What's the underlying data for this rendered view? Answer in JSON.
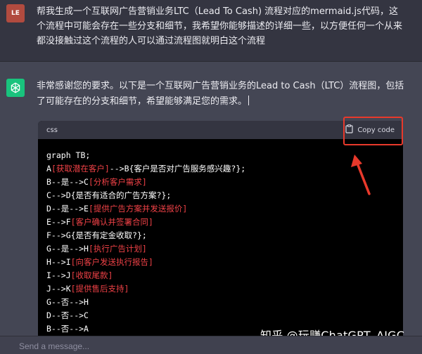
{
  "user_message": {
    "avatar_initials": "LE",
    "text": "帮我生成一个互联网广告营销业务LTC（Lead To Cash) 流程对应的mermaid.js代码，这个流程中可能会存在一些分支和细节，我希望你能够描述的详细一些，以方便任何一个从来都没接触过这个流程的人可以通过流程图就明白这个流程"
  },
  "assistant_message": {
    "text": "非常感谢您的要求。以下是一个互联网广告营销业务的Lead to Cash（LTC）流程图，包括了可能存在的分支和细节，希望能够满足您的需求。"
  },
  "code_block": {
    "language": "css",
    "copy_label": "Copy code",
    "lines": [
      [
        {
          "t": "graph TB;"
        }
      ],
      [
        {
          "t": "A"
        },
        {
          "t": "[获取潜在客户]",
          "h": true
        },
        {
          "t": "-->B{客户是否对广告服务感兴趣?};"
        }
      ],
      [
        {
          "t": "B--是-->C"
        },
        {
          "t": "[分析客户需求]",
          "h": true
        }
      ],
      [
        {
          "t": "C-->D{是否有适合的广告方案?};"
        }
      ],
      [
        {
          "t": "D--是-->E"
        },
        {
          "t": "[提供广告方案并发送报价]",
          "h": true
        }
      ],
      [
        {
          "t": "E-->F"
        },
        {
          "t": "[客户确认并签署合同]",
          "h": true
        }
      ],
      [
        {
          "t": "F-->G{是否有定金收取?};"
        }
      ],
      [
        {
          "t": "G--是-->H"
        },
        {
          "t": "[执行广告计划]",
          "h": true
        }
      ],
      [
        {
          "t": "H-->I"
        },
        {
          "t": "[向客户发送执行报告]",
          "h": true
        }
      ],
      [
        {
          "t": "I-->J"
        },
        {
          "t": "[收取尾款]",
          "h": true
        }
      ],
      [
        {
          "t": "J-->K"
        },
        {
          "t": "[提供售后支持]",
          "h": true
        }
      ],
      [
        {
          "t": "G--否-->H"
        }
      ],
      [
        {
          "t": "D--否-->C"
        }
      ],
      [
        {
          "t": "B--否-->A"
        }
      ]
    ]
  },
  "input": {
    "placeholder": "Send a message..."
  },
  "watermark": "知乎 @玩赚ChatGPT_AIGC",
  "colors": {
    "highlight": "#ef4146",
    "annotation": "#e8392b",
    "assistant_avatar": "#19c37d"
  },
  "icons": {
    "assistant_avatar": "openai-logo-icon",
    "copy": "clipboard-icon"
  }
}
